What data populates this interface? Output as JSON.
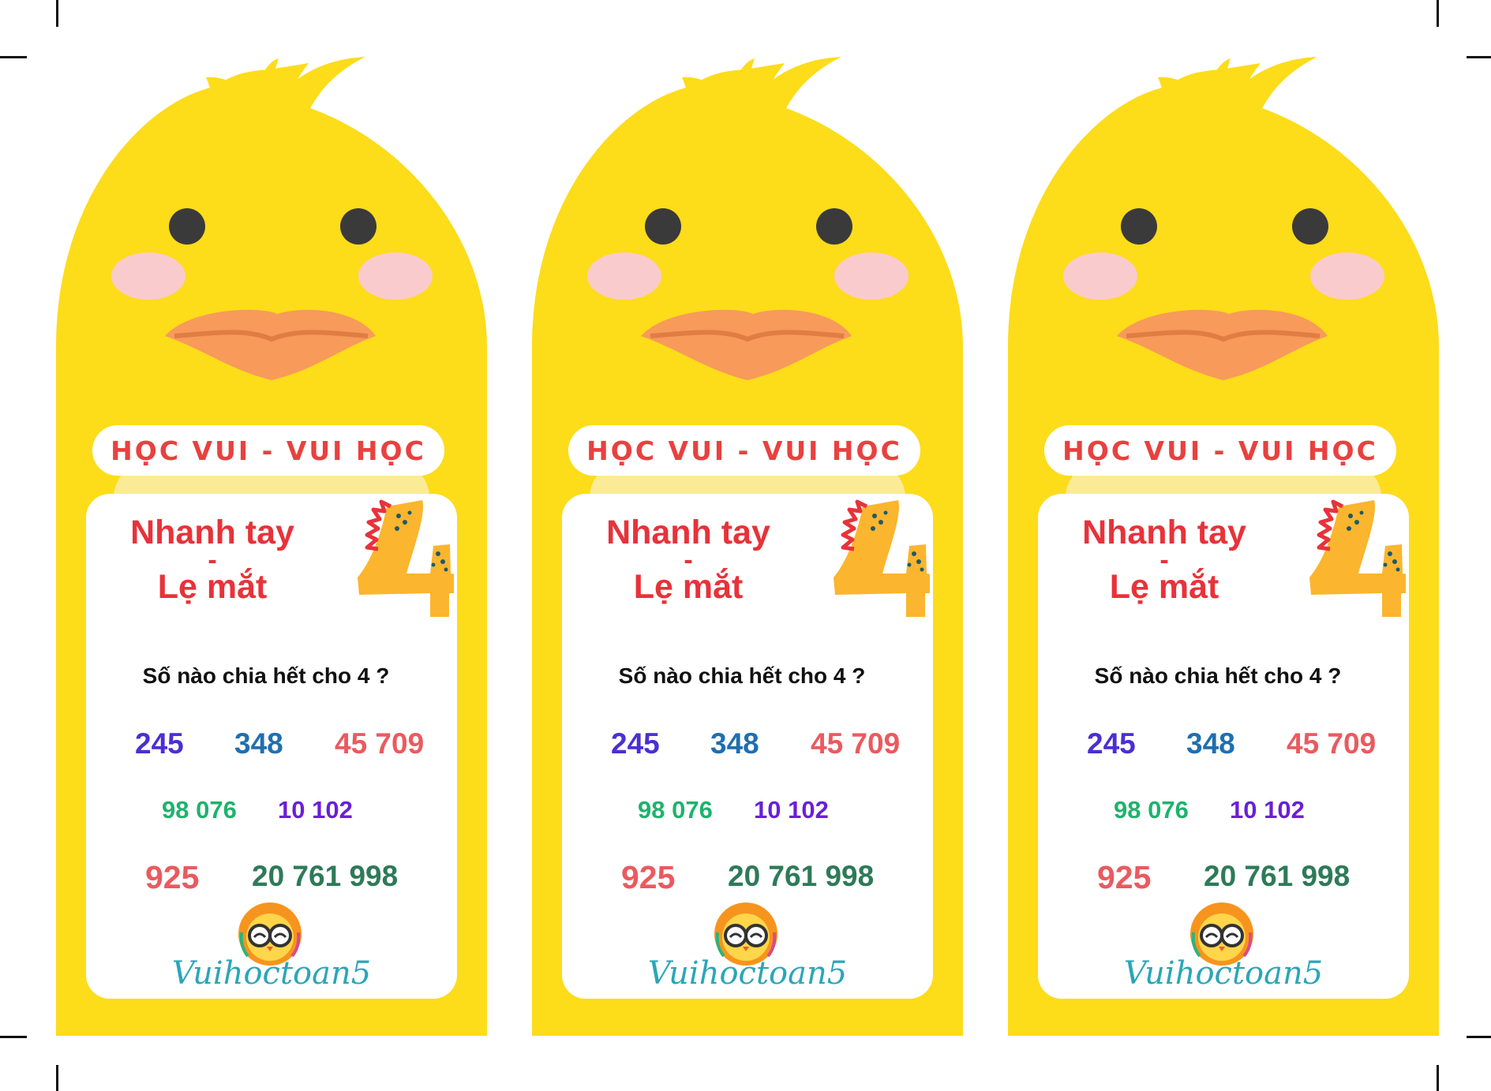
{
  "colors": {
    "duck_yellow": "#fddc1a",
    "belly": "#fbeb96",
    "cheek": "#f9cbcc",
    "beak": "#f79a5a",
    "beak_shadow": "#e07d43",
    "eye": "#3a3a3a",
    "title_red": "#e8323a",
    "number_yellow": "#fbb52e"
  },
  "cards": [
    {
      "banner": "HỌC VUI - VUI HỌC",
      "title_line1": "Nhanh tay",
      "title_dash": "-",
      "title_line2": "Lẹ mắt",
      "digit_icon": "digit-four-dinosaur-icon",
      "question": "Số nào chia hết cho 4 ?",
      "numbers": [
        {
          "text": "245",
          "color": "#4b2fd1"
        },
        {
          "text": "348",
          "color": "#1f6fb0"
        },
        {
          "text": "45 709",
          "color": "#ea5a5f"
        },
        {
          "text": "98 076",
          "color": "#1db36c"
        },
        {
          "text": "10 102",
          "color": "#6a1fd6"
        },
        {
          "text": "925",
          "color": "#ea5a5f"
        },
        {
          "text": "20 761 998",
          "color": "#2e7a58"
        }
      ],
      "logo_icon": "owl-logo-icon",
      "brand": "Vuihoctoan5"
    },
    {
      "banner": "HỌC VUI - VUI HỌC",
      "title_line1": "Nhanh tay",
      "title_dash": "-",
      "title_line2": "Lẹ mắt",
      "digit_icon": "digit-four-dinosaur-icon",
      "question": "Số nào chia hết cho 4 ?",
      "numbers": [
        {
          "text": "245",
          "color": "#4b2fd1"
        },
        {
          "text": "348",
          "color": "#1f6fb0"
        },
        {
          "text": "45 709",
          "color": "#ea5a5f"
        },
        {
          "text": "98 076",
          "color": "#1db36c"
        },
        {
          "text": "10 102",
          "color": "#6a1fd6"
        },
        {
          "text": "925",
          "color": "#ea5a5f"
        },
        {
          "text": "20 761 998",
          "color": "#2e7a58"
        }
      ],
      "logo_icon": "owl-logo-icon",
      "brand": "Vuihoctoan5"
    },
    {
      "banner": "HỌC VUI - VUI HỌC",
      "title_line1": "Nhanh tay",
      "title_dash": "-",
      "title_line2": "Lẹ mắt",
      "digit_icon": "digit-four-dinosaur-icon",
      "question": "Số nào chia hết cho 4 ?",
      "numbers": [
        {
          "text": "245",
          "color": "#4b2fd1"
        },
        {
          "text": "348",
          "color": "#1f6fb0"
        },
        {
          "text": "45 709",
          "color": "#ea5a5f"
        },
        {
          "text": "98 076",
          "color": "#1db36c"
        },
        {
          "text": "10 102",
          "color": "#6a1fd6"
        },
        {
          "text": "925",
          "color": "#ea5a5f"
        },
        {
          "text": "20 761 998",
          "color": "#2e7a58"
        }
      ],
      "logo_icon": "owl-logo-icon",
      "brand": "Vuihoctoan5"
    }
  ]
}
